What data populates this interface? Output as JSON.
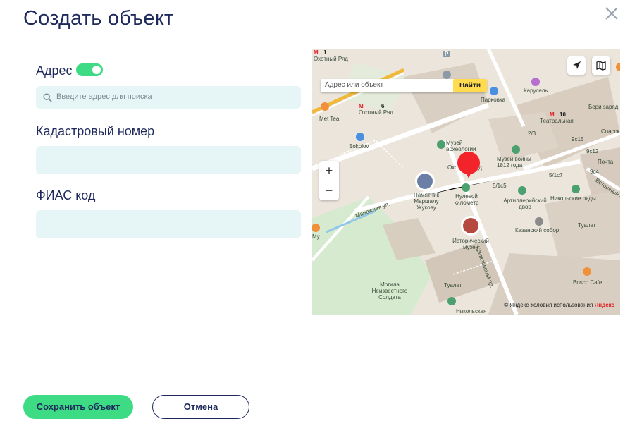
{
  "dialog": {
    "title": "Создать объект",
    "close_icon": "close-icon"
  },
  "form": {
    "address_label": "Адрес",
    "address_toggle_on": true,
    "search_placeholder": "Введите адрес для поиска",
    "cadastral_label": "Кадастровый номер",
    "cadastral_value": "",
    "fias_label": "ФИАС код",
    "fias_value": ""
  },
  "map": {
    "search_placeholder": "Адрес или объект",
    "find_button": "Найти",
    "zoom_in": "+",
    "zoom_out": "−",
    "footer_copyright": "© Яндекс",
    "footer_terms": "Условия использования",
    "footer_brand": "Яндекс",
    "labels": {
      "okhotny_ryad_top": "Охотный Ряд",
      "okhotny_ryad": "Охотный Ряд",
      "okhotny_ryad_center": "Охотный Ряд",
      "carousel": "Карусель",
      "parkovka": "Парковка",
      "teatralnaya": "Театральная",
      "beri_zaryadi": "Бери заряд!",
      "spassk": "Спасск",
      "met_tea": "Met Tea",
      "sokolov": "Sokolov",
      "museum_archaeology": "Музей археологии",
      "museum_1812": "Музей войны 1812 года",
      "monument_zhukov": "Памятник Маршалу Жукову",
      "zero_km": "Нулевой километр",
      "artillery_yard": "Артиллерийский двор",
      "nikolskie_ryady": "Никольские ряды",
      "kazan_cathedral": "Казанский собор",
      "historical_museum": "Исторический музей",
      "manezhnaya": "Манежная ул.",
      "vetoshny": "Ветошный пр.",
      "kremlevsky": "Кремлёвский пр.",
      "tualet_1": "Туалет",
      "tualet_2": "Туалет",
      "tomb": "Могила Неизвестного Солдата",
      "bosco": "Bosco Cafe",
      "nikolskaya": "Никольская",
      "pochta": "Почта",
      "num_23": "2/3",
      "num_9c15": "9с15",
      "num_9c12": "9с12",
      "num_5c1c5": "5/1с5",
      "num_5c1c7": "5/1с7",
      "num_9c4": "9с4",
      "metro_m1": "М",
      "metro_m2": "М",
      "metro_m3": "М",
      "metro_m4": "М",
      "line_1": "1",
      "line_2": "6",
      "line_3": "10",
      "parking_p": "P",
      "sh": "Му"
    }
  },
  "actions": {
    "save": "Сохранить объект",
    "cancel": "Отмена"
  },
  "colors": {
    "accent_green": "#3ddc84",
    "field_bg": "#e6f6f6",
    "text_navy": "#1f2a5c",
    "pin_red": "#f2232b",
    "yandex_yellow": "#ffdb4d"
  }
}
